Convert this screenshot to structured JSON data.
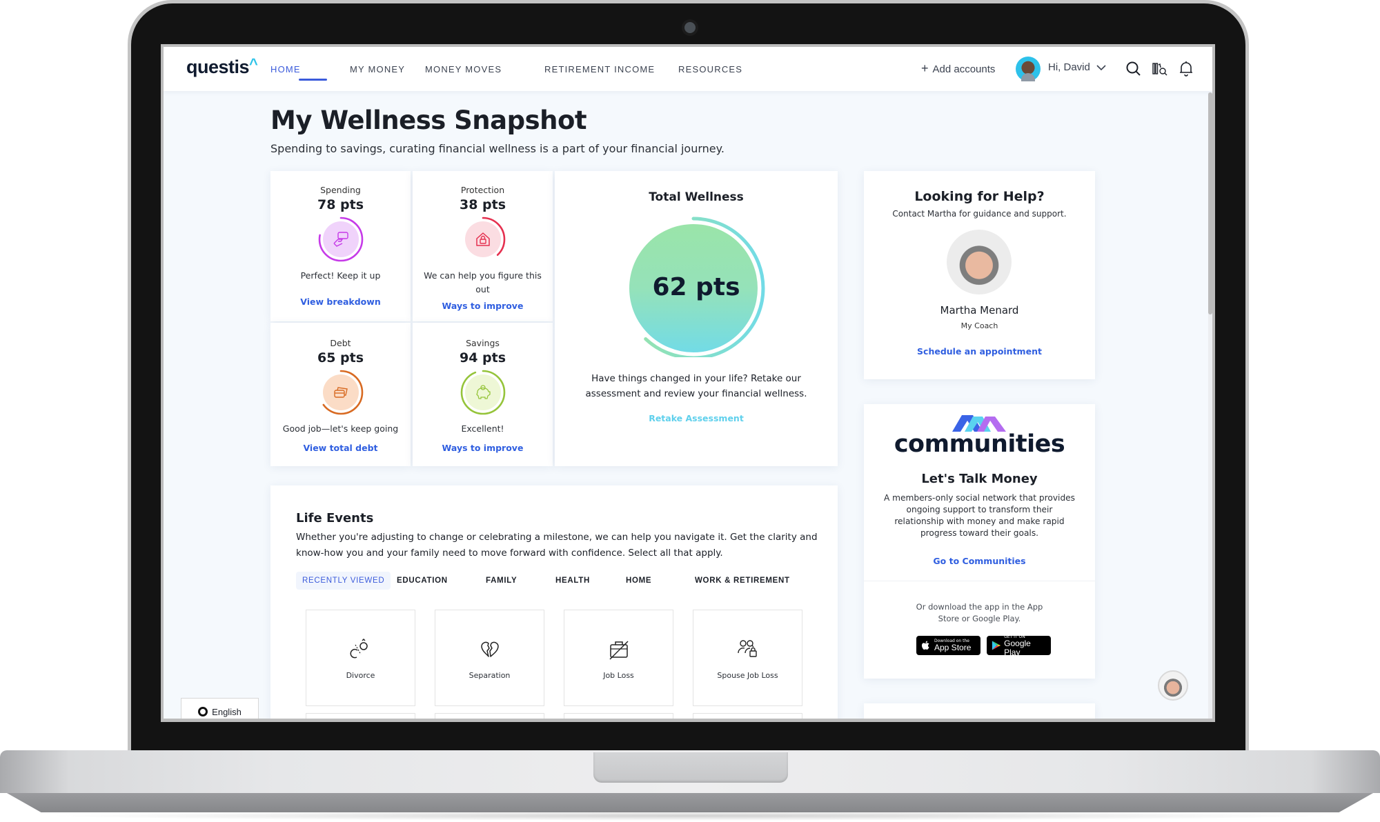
{
  "nav": {
    "logo": "questis",
    "logo_caret": "^",
    "items": [
      {
        "label": "HOME",
        "active": true
      },
      {
        "label": "MY MONEY",
        "active": false
      },
      {
        "label": "MONEY MOVES",
        "active": false
      },
      {
        "label": "RETIREMENT INCOME",
        "active": false
      },
      {
        "label": "RESOURCES",
        "active": false
      }
    ],
    "add_accounts": "Add accounts",
    "greeting": "Hi, David",
    "icons": [
      "search-icon",
      "library-search-icon",
      "bell-icon"
    ]
  },
  "page": {
    "title": "My Wellness Snapshot",
    "subtitle": "Spending to savings, curating financial wellness is a part of your financial journey."
  },
  "wellness": {
    "categories": [
      {
        "label": "Spending",
        "points": "78 pts",
        "score": 78,
        "message": "Perfect! Keep it up",
        "link": "View breakdown",
        "color": "#c63ae8",
        "bg": "#f0d3fb",
        "icon": "card-in-hand-icon"
      },
      {
        "label": "Protection",
        "points": "38 pts",
        "score": 38,
        "message": "We can help you figure this out",
        "link": "Ways to improve",
        "color": "#e5304f",
        "bg": "#fbdde2",
        "icon": "house-lock-icon"
      },
      {
        "label": "Debt",
        "points": "65 pts",
        "score": 65,
        "message": "Good job—let's keep going",
        "link": "View total debt",
        "color": "#d86a22",
        "bg": "#fbdcc6",
        "icon": "credit-cards-icon"
      },
      {
        "label": "Savings",
        "points": "94 pts",
        "score": 94,
        "message": "Excellent!",
        "link": "Ways to improve",
        "color": "#95c43a",
        "bg": "#eef7d6",
        "icon": "piggy-bank-icon"
      }
    ],
    "total": {
      "title": "Total Wellness",
      "points": "62 pts",
      "score": 62,
      "description": "Have things changed in your life? Retake our assessment and review your financial wellness.",
      "link": "Retake Assessment"
    }
  },
  "help": {
    "title": "Looking for Help?",
    "subtitle": "Contact Martha for guidance and support.",
    "coach_name": "Martha Menard",
    "coach_role": "My Coach",
    "link": "Schedule an appointment"
  },
  "communities": {
    "brand": "communities",
    "title": "Let's Talk Money",
    "description": "A members-only social network that provides ongoing support to transform their relationship with money and make rapid progress toward their goals.",
    "link": "Go to Communities",
    "download_text": "Or download the app in the App Store or Google Play.",
    "app_store": {
      "small": "Download on the",
      "large": "App Store"
    },
    "google_play": {
      "small": "GET IT ON",
      "large": "Google Play"
    }
  },
  "life_events": {
    "title": "Life Events",
    "description": "Whether you're adjusting to change or celebrating a milestone, we can help you navigate it. Get the clarity and know-how you and your family need to move forward with confidence. Select all that apply.",
    "tabs": [
      {
        "label": "RECENTLY VIEWED",
        "active": true
      },
      {
        "label": "EDUCATION",
        "active": false
      },
      {
        "label": "FAMILY",
        "active": false
      },
      {
        "label": "HEALTH",
        "active": false
      },
      {
        "label": "HOME",
        "active": false
      },
      {
        "label": "WORK & RETIREMENT",
        "active": false
      }
    ],
    "tiles": [
      {
        "label": "Divorce",
        "icon": "broken-ring-icon"
      },
      {
        "label": "Separation",
        "icon": "broken-heart-icon"
      },
      {
        "label": "Job Loss",
        "icon": "crossed-briefcase-icon"
      },
      {
        "label": "Spouse Job Loss",
        "icon": "people-lock-icon"
      }
    ]
  },
  "language": {
    "label": "English"
  },
  "colors": {
    "accent": "#3b5bdb",
    "link": "#2f5ee0",
    "retake": "#5fd0ec",
    "background": "#f5f9fd"
  }
}
